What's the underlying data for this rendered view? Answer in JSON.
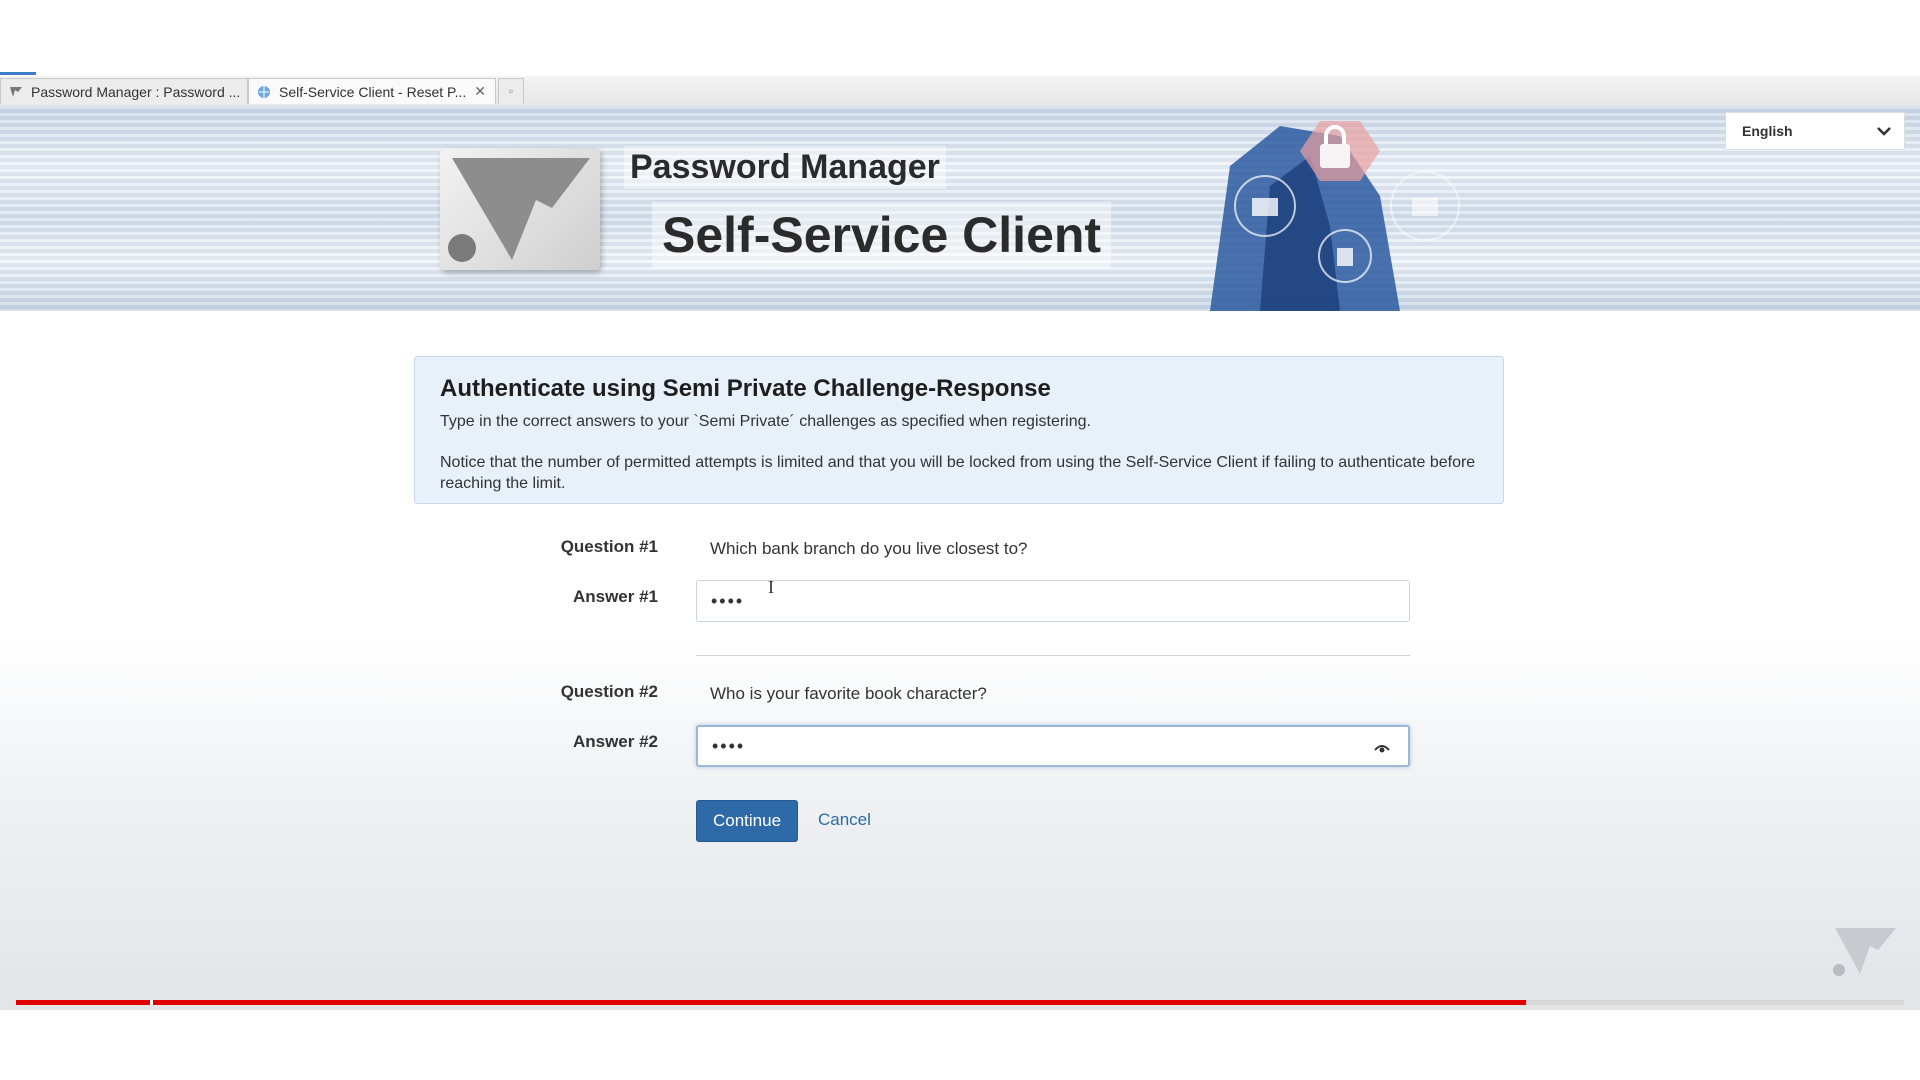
{
  "browser": {
    "tabs": [
      {
        "title": "Password Manager : Password ...",
        "active": false
      },
      {
        "title": "Self-Service Client - Reset P...",
        "active": true
      }
    ]
  },
  "header": {
    "title": "Password Manager",
    "subtitle": "Self-Service Client",
    "language": "English"
  },
  "info": {
    "title": "Authenticate using Semi Private Challenge-Response",
    "text1": "Type in the correct answers to your `Semi Private´ challenges as specified when registering.",
    "text2": "Notice that the number of permitted attempts is limited and that you will be locked from using the Self-Service Client if failing to authenticate before reaching the limit."
  },
  "form": {
    "question1_label": "Question #1",
    "question1_text": "Which bank branch do you live closest to?",
    "answer1_label": "Answer #1",
    "answer1_value": "••••",
    "question2_label": "Question #2",
    "question2_text": "Who is your favorite book character?",
    "answer2_label": "Answer #2",
    "answer2_value": "••••",
    "continue_label": "Continue",
    "cancel_label": "Cancel"
  },
  "video": {
    "progress": 0.8
  },
  "colors": {
    "primary": "#2f6aa8",
    "progress": "#e00000",
    "info_bg": "#e8f0f9"
  }
}
